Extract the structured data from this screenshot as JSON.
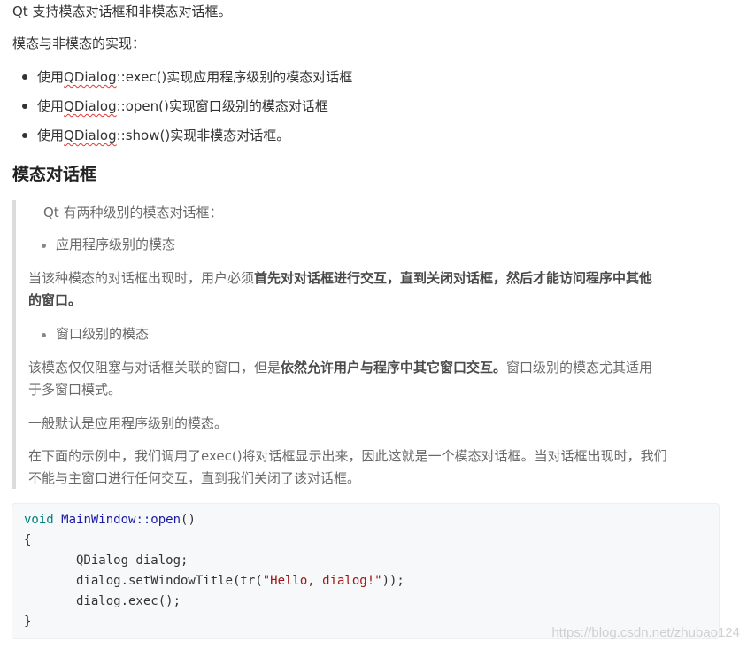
{
  "intro": "Qt 支持模态对话框和非模态对话框。",
  "impl_label": "模态与非模态的实现：",
  "methods": [
    {
      "prefix": "使用",
      "class": "QDialog",
      "rest": "::exec()实现应用程序级别的模态对话框"
    },
    {
      "prefix": "使用",
      "class": "QDialog",
      "rest": "::open()实现窗口级别的模态对话框"
    },
    {
      "prefix": "使用",
      "class": "QDialog",
      "rest": "::show()实现非模态对话框。"
    }
  ],
  "heading": "模态对话框",
  "quote": {
    "levels_intro": "Qt 有两种级别的模态对话框：",
    "bullet1": "应用程序级别的模态",
    "para1_start": "当该种模态的对话框出现时，用户必须",
    "para1_bold_a": "首先对对话框进行交互，直到关闭对话框，然后才能访问程序中其他",
    "para1_bold_b": "的窗口。",
    "bullet2": "窗口级别的模态",
    "para2_start_a": "该模态仅仅阻塞与对话框关联的窗口，但是",
    "para2_bold": "依然允许用户与程序中其它窗口交互。",
    "para2_end_a": "窗口级别的模态尤其适用",
    "para2_end_b": "于多窗口模式。",
    "para3": "一般默认是应用程序级别的模态。",
    "para4_a": "在下面的示例中，我们调用了exec()将对话框显示出来，因此这就是一个模态对话框。当对话框出现时，我们",
    "para4_b": "不能与主窗口进行任何交互，直到我们关闭了该对话框。"
  },
  "code": {
    "l1_kw": "void",
    "l1_fn": "MainWindow::open",
    "l1_rest": "()",
    "l2": "{",
    "l3": "       QDialog dialog;",
    "l4_a": "       dialog.setWindowTitle(tr(",
    "l4_str": "\"Hello, dialog!\"",
    "l4_b": "));",
    "l5": "       dialog.exec();",
    "l6": "}"
  },
  "watermark": "https://blog.csdn.net/zhubao124"
}
